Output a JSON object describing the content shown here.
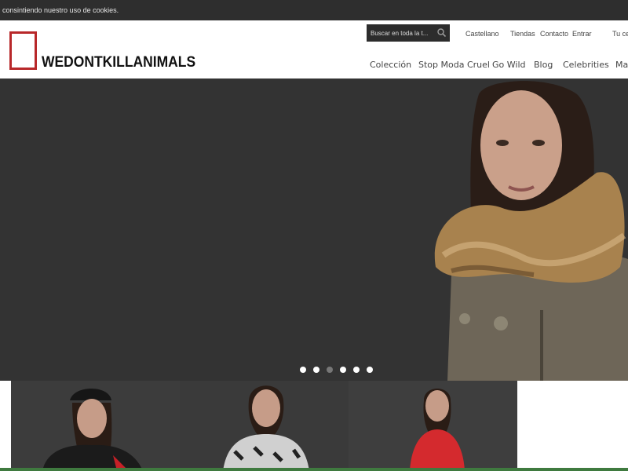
{
  "cookie_bar": {
    "text": "consintiendo nuestro uso de cookies."
  },
  "brand": {
    "logo_text": "WEDONTKILLANIMALS",
    "accent": "#b8282a"
  },
  "search": {
    "placeholder": "Buscar en toda la t..."
  },
  "top_links": [
    "Castellano",
    "Tiendas",
    "Contacto",
    "Entrar",
    "Tu ce"
  ],
  "main_nav": [
    "Colección",
    "Stop Moda Cruel",
    "Go Wild",
    "Blog",
    "Celebrities",
    "Ma"
  ],
  "slider": {
    "slide_count": 6,
    "active_index": 2
  },
  "colors": {
    "header_dark": "#2e2e2e",
    "hero_bg": "#333333",
    "strip": "#3f7a3f"
  }
}
